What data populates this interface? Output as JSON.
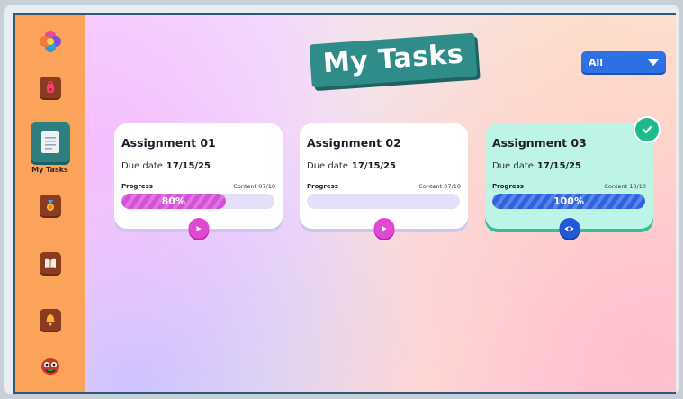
{
  "sidebar": {
    "items": [
      {
        "name": "logo",
        "icon": "flower-logo-icon"
      },
      {
        "name": "backpack",
        "icon": "backpack-icon"
      },
      {
        "name": "tasks",
        "icon": "notepad-icon",
        "label": "My Tasks",
        "active": true
      },
      {
        "name": "medal",
        "icon": "medal-icon"
      },
      {
        "name": "book",
        "icon": "book-icon"
      },
      {
        "name": "bell",
        "icon": "bell-icon"
      },
      {
        "name": "avatar",
        "icon": "monster-avatar-icon"
      }
    ]
  },
  "header": {
    "title": "My Tasks"
  },
  "filter": {
    "selected": "All"
  },
  "cards": [
    {
      "title": "Assignment 01",
      "due_label": "Due date",
      "due_date": "17/15/25",
      "progress_label": "Progress",
      "content": "Content 07/10",
      "progress_percent": 80,
      "progress_text": "80%",
      "action": "play",
      "completed": false
    },
    {
      "title": "Assignment 02",
      "due_label": "Due date",
      "due_date": "17/15/25",
      "progress_label": "Progress",
      "content": "Content 07/10",
      "progress_percent": 0,
      "progress_text": "",
      "action": "play",
      "completed": false
    },
    {
      "title": "Assignment 03",
      "due_label": "Due date",
      "due_date": "17/15/25",
      "progress_label": "Progress",
      "content": "Content 10/10",
      "progress_percent": 100,
      "progress_text": "100%",
      "action": "view",
      "completed": true
    }
  ],
  "colors": {
    "sidebar": "#fba35a",
    "accent_teal": "#2f8c88",
    "filter_blue": "#2e6fe3",
    "progress_pink": "#d64fd8",
    "progress_blue": "#2f62e0",
    "done_card": "#bdf4e6",
    "check_green": "#1fb98e"
  }
}
